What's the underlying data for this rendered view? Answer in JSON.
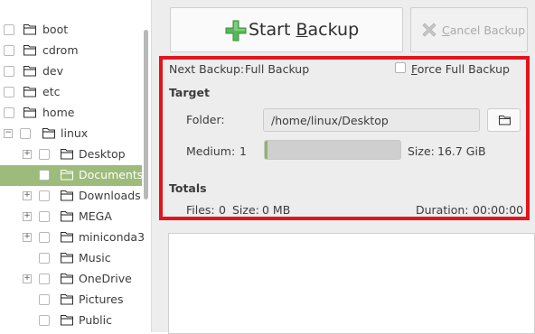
{
  "tree": {
    "items": [
      {
        "label": "boot",
        "level": 0,
        "expander": "",
        "selected": false,
        "icon": "folder-icon"
      },
      {
        "label": "cdrom",
        "level": 0,
        "expander": "",
        "selected": false,
        "icon": "folder-icon"
      },
      {
        "label": "dev",
        "level": 0,
        "expander": "",
        "selected": false,
        "icon": "folder-icon"
      },
      {
        "label": "etc",
        "level": 0,
        "expander": "",
        "selected": false,
        "icon": "folder-icon"
      },
      {
        "label": "home",
        "level": 0,
        "expander": "",
        "selected": false,
        "icon": "folder-icon"
      },
      {
        "label": "linux",
        "level": 1,
        "expander": "−",
        "selected": false,
        "icon": "folder-icon"
      },
      {
        "label": "Desktop",
        "level": 2,
        "expander": "+",
        "selected": false,
        "icon": "folder-icon"
      },
      {
        "label": "Documents",
        "level": 2,
        "expander": "",
        "selected": true,
        "icon": "folder-icon"
      },
      {
        "label": "Downloads",
        "level": 2,
        "expander": "+",
        "selected": false,
        "icon": "folder-icon"
      },
      {
        "label": "MEGA",
        "level": 2,
        "expander": "+",
        "selected": false,
        "icon": "folder-icon"
      },
      {
        "label": "miniconda3",
        "level": 2,
        "expander": "+",
        "selected": false,
        "icon": "folder-icon"
      },
      {
        "label": "Music",
        "level": 2,
        "expander": "",
        "selected": false,
        "icon": "folder-icon"
      },
      {
        "label": "OneDrive",
        "level": 2,
        "expander": "+",
        "selected": false,
        "icon": "folder-icon"
      },
      {
        "label": "Pictures",
        "level": 2,
        "expander": "",
        "selected": false,
        "icon": "folder-icon"
      },
      {
        "label": "Public",
        "level": 2,
        "expander": "",
        "selected": false,
        "icon": "folder-icon"
      }
    ]
  },
  "toolbar": {
    "start_label_pre": "Start ",
    "start_label_mnemonic": "B",
    "start_label_post": "ackup",
    "start_icon": "green-plus-icon",
    "cancel_label_pre": "",
    "cancel_label_mnemonic": "C",
    "cancel_label_post": "ancel Backup",
    "cancel_icon": "grey-x-icon"
  },
  "info": {
    "next_backup_label": "Next Backup:",
    "next_backup_value": "Full Backup",
    "force_label_pre": "",
    "force_label_mnemonic": "F",
    "force_label_post": "orce Full Backup",
    "force_checked": false,
    "target_heading": "Target",
    "folder_label": "Folder:",
    "folder_value": "/home/linux/Desktop",
    "browse_icon": "folder-icon",
    "medium_label": "Medium:",
    "medium_value": "1",
    "medium_fill_fraction": 0.02,
    "size_label": "Size:",
    "size_value": "16.7 GiB",
    "totals_heading": "Totals",
    "files_label": "Files:",
    "files_value": "0",
    "size_total_label": "Size:",
    "size_total_value": "0 MB",
    "duration_label": "Duration:",
    "duration_value": "00:00:00"
  },
  "colors": {
    "highlight_border": "#e2141c",
    "selected_row": "#9dbb7a",
    "progress_fill": "#8fb56a",
    "plus_icon": "#4caf50"
  }
}
